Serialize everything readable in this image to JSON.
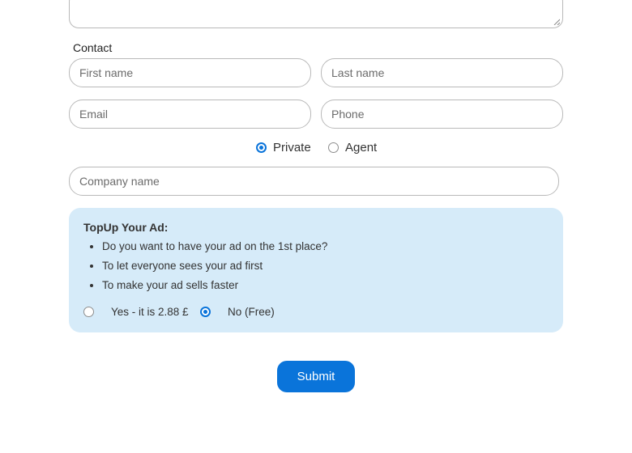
{
  "contact": {
    "label": "Contact",
    "first_name_placeholder": "First name",
    "last_name_placeholder": "Last name",
    "email_placeholder": "Email",
    "phone_placeholder": "Phone",
    "seller_type": {
      "options": [
        "Private",
        "Agent"
      ],
      "selected": "Private"
    },
    "company_placeholder": "Company name"
  },
  "topup": {
    "title": "TopUp Your Ad:",
    "bullets": [
      "Do you want to have your ad on the 1st place?",
      "To let everyone sees your ad first",
      "To make your ad sells faster"
    ],
    "options": [
      "Yes - it is 2.88 £",
      "No (Free)"
    ],
    "selected": "No (Free)",
    "background": "#d6ebf9"
  },
  "submit_label": "Submit",
  "colors": {
    "accent": "#0a74da"
  }
}
